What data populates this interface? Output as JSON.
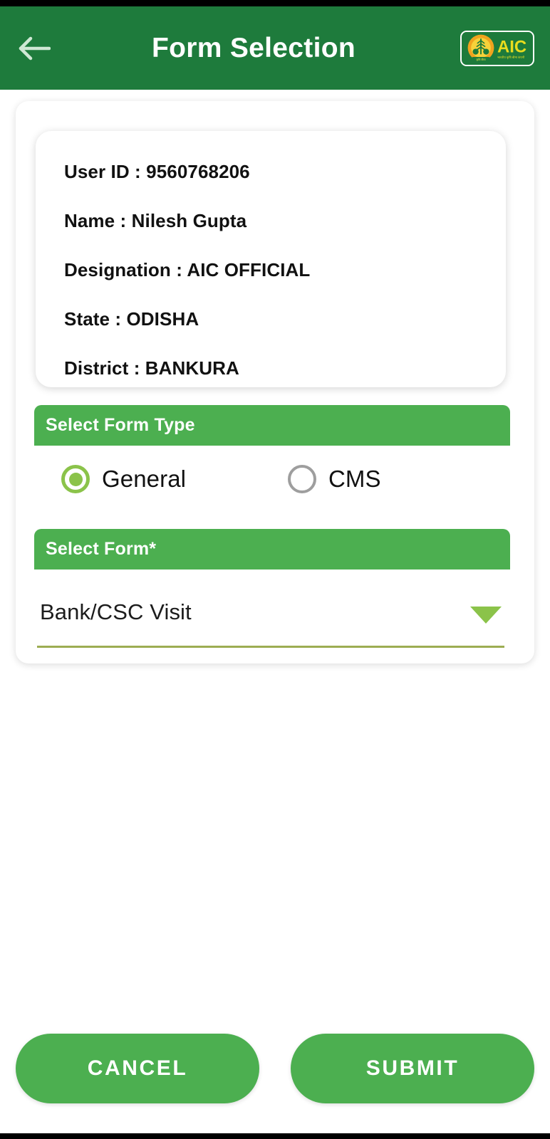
{
  "app": {
    "title": "Form Selection",
    "brand": {
      "logo_text": "AIC",
      "logo_subtext": "भारतीय कृषि बीमा कंपनी",
      "logo_badge_text": "कृषि बीमा भारत"
    },
    "colors": {
      "appbar_green": "#1E7B3C",
      "section_green": "#4CAF50",
      "accent_lime": "#8BC34A",
      "underline_olive": "#9CAD52",
      "radio_off_gray": "#9E9E9E",
      "logo_yellow": "#E8DC1E",
      "logo_orange": "#F0A31E",
      "text_dark": "#111111",
      "white": "#FFFFFF"
    }
  },
  "nav": {
    "back_icon": "arrow-left-icon"
  },
  "user_info": {
    "rows": [
      "User ID : 9560768206",
      "Name : Nilesh Gupta",
      "Designation : AIC OFFICIAL",
      "State : ODISHA",
      "District : BANKURA"
    ],
    "fields": {
      "user_id_label": "User ID :",
      "user_id_value": "9560768206",
      "name_label": "Name :",
      "name_value": "Nilesh Gupta",
      "designation_label": "Designation :",
      "designation_value": "AIC OFFICIAL",
      "state_label": "State :",
      "state_value": "ODISHA",
      "district_label": "District :",
      "district_value": "BANKURA"
    }
  },
  "form_type": {
    "header": "Select Form Type",
    "options": [
      {
        "label": "General",
        "selected": true
      },
      {
        "label": "CMS",
        "selected": false
      }
    ]
  },
  "select_form": {
    "header": "Select Form*",
    "selected_value": "Bank/CSC Visit",
    "caret_icon": "chevron-down-icon"
  },
  "actions": {
    "cancel_label": "CANCEL",
    "submit_label": "SUBMIT"
  }
}
